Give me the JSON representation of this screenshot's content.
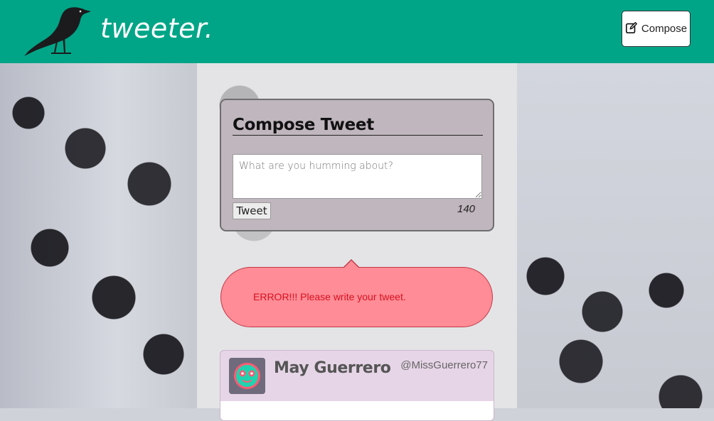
{
  "header": {
    "brand": "tweeter.",
    "compose_label": "Compose",
    "logo_icon": "crow-logo-icon",
    "compose_icon": "edit-icon"
  },
  "compose": {
    "title": "Compose Tweet",
    "placeholder": "What are you humming about?",
    "value": "",
    "submit_label": "Tweet",
    "counter": "140"
  },
  "error": {
    "message": "ERROR!!! Please write your tweet."
  },
  "tweets": [
    {
      "name": "May Guerrero",
      "handle": "@MissGuerrero77",
      "avatar_icon": "face-avatar-icon"
    }
  ],
  "colors": {
    "header": "#00a587",
    "compose_panel": "#c0b6bd",
    "error_bg": "#ff8c96",
    "error_text": "#d8111f",
    "tweet_card": "#e6d5e6"
  }
}
